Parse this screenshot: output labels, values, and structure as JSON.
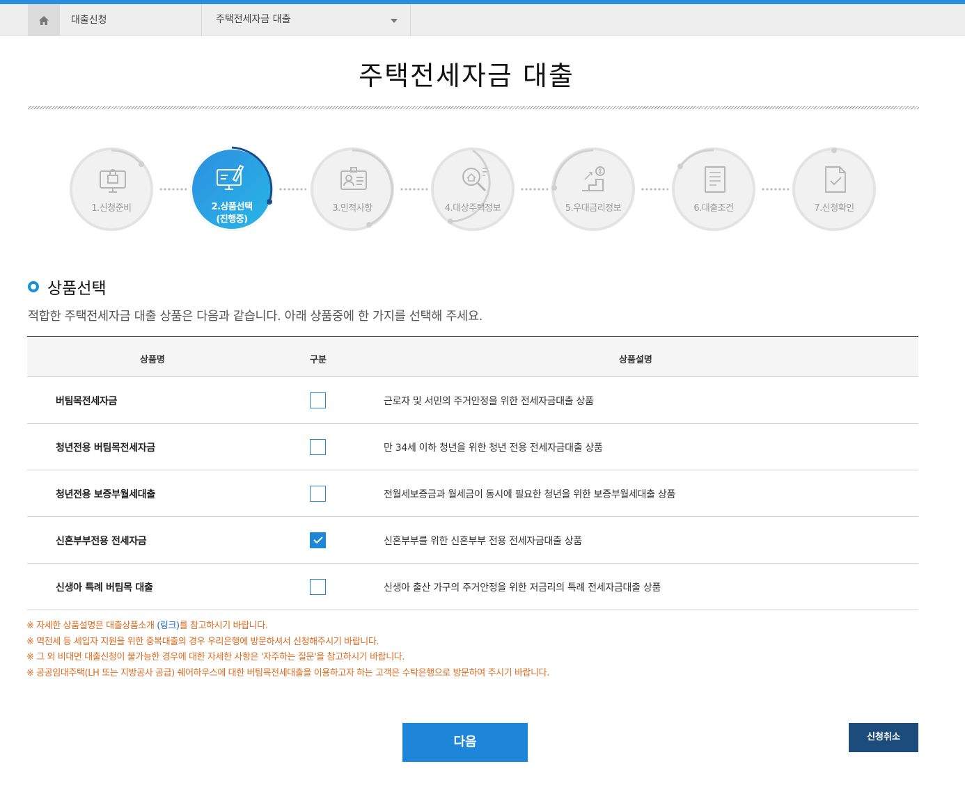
{
  "nav": {
    "home_icon": "home-icon",
    "crumb": "대출신청",
    "select_value": "주택전세자금 대출"
  },
  "page_title": "주택전세자금 대출",
  "steps": [
    {
      "label": "1.신청준비",
      "state": "done"
    },
    {
      "label": "2.상품선택",
      "sub": "(진행중)",
      "state": "current"
    },
    {
      "label": "3.인적사항",
      "state": "todo"
    },
    {
      "label": "4.대상주택정보",
      "state": "todo"
    },
    {
      "label": "5.우대금리정보",
      "state": "todo"
    },
    {
      "label": "6.대출조건",
      "state": "todo"
    },
    {
      "label": "7.신청확인",
      "state": "todo"
    }
  ],
  "section": {
    "title": "상품선택",
    "description": "적합한 주택전세자금 대출 상품은 다음과 같습니다. 아래 상품중에 한 가지를 선택해 주세요."
  },
  "table": {
    "headers": {
      "name": "상품명",
      "type": "구분",
      "desc": "상품설명"
    },
    "rows": [
      {
        "name": "버팀목전세자금",
        "checked": false,
        "desc": "근로자 및 서민의 주거안정을 위한 전세자금대출 상품"
      },
      {
        "name": "청년전용 버팀목전세자금",
        "checked": false,
        "desc": "만 34세 이하 청년을 위한 청년 전용 전세자금대출 상품"
      },
      {
        "name": "청년전용 보증부월세대출",
        "checked": false,
        "desc": "전월세보증금과 월세금이 동시에 필요한 청년을 위한 보증부월세대출 상품"
      },
      {
        "name": "신혼부부전용 전세자금",
        "checked": true,
        "desc": "신혼부부를 위한 신혼부부 전용 전세자금대출 상품"
      },
      {
        "name": "신생아 특례 버팀목 대출",
        "checked": false,
        "desc": "신생아 출산 가구의 주거안정을 위한 저금리의 특례 전세자금대출 상품"
      }
    ]
  },
  "notes": {
    "n1_pre": "※ 자세한 상품설명은 대출상품소개 ",
    "n1_link": "(링크)",
    "n1_post": "를 참고하시기 바랍니다.",
    "n2": "※ 역전세 등 세입자 지원을 위한 중복대출의 경우 우리은행에 방문하셔서 신청해주시기 바랍니다.",
    "n3": "※  그 외 비대면 대출신청이 불가능한 경우에 대한 자세한 사항은 '자주하는 질문'을 참고하시기 바랍니다.",
    "n4": "※ 공공임대주택(LH 또는 지방공사 공급) 쉐어하우스에 대한 버팀목전세대출을 이용하고자 하는 고객은 수탁은행으로 방문하여 주시기 바랍니다."
  },
  "buttons": {
    "next": "다음",
    "cancel": "신청취소"
  },
  "colors": {
    "accent": "#1d86d8",
    "note": "#e06a1e",
    "cancel": "#1c4c7c"
  }
}
